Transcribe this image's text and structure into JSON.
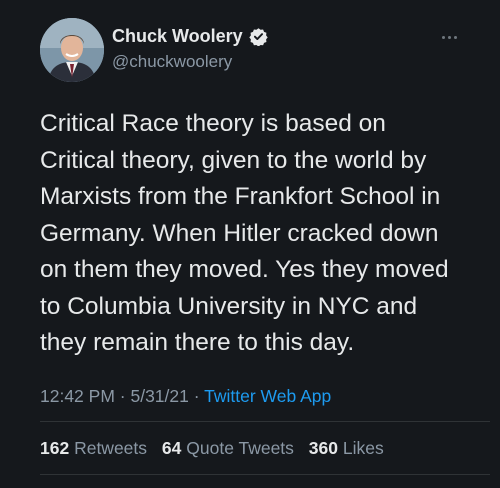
{
  "user": {
    "display_name": "Chuck Woolery",
    "handle": "@chuckwoolery",
    "verified_icon": "verified-badge-icon",
    "avatar": "profile-photo"
  },
  "tweet": {
    "lines": [
      "Critical Race theory is based on",
      "Critical theory, given to the world by",
      "Marxists from the Frankfort School in",
      "Germany. When Hitler cracked down",
      "on them they moved. Yes they moved",
      "to Columbia University in NYC and",
      "they remain there to this day."
    ],
    "time": "12:42 PM",
    "date": "5/31/21",
    "source": "Twitter Web App",
    "separator": "·"
  },
  "stats": {
    "retweets_count": "162",
    "retweets_label": "Retweets",
    "quotes_count": "64",
    "quotes_label": "Quote Tweets",
    "likes_count": "360",
    "likes_label": "Likes"
  },
  "colors": {
    "background": "#15181c",
    "text": "#e7e9ea",
    "muted": "#8b98a5",
    "link": "#1d9bf0"
  }
}
